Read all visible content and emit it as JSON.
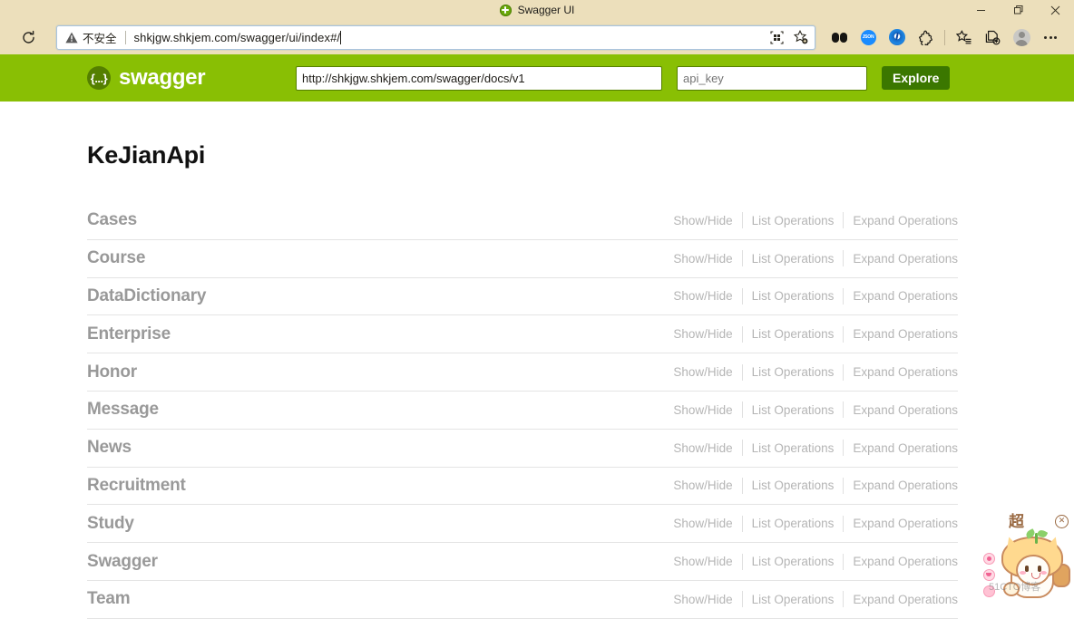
{
  "browser": {
    "tab": {
      "title": "Swagger UI",
      "favicon": "swagger-favicon"
    },
    "window_controls": {
      "minimize": "–",
      "restore": "❐",
      "close": "✕"
    },
    "toolbar": {
      "reload_label": "Reload",
      "security_label": "不安全",
      "url": "shkjgw.shkjem.com/swagger/ui/index#/",
      "qr_icon": "qr-code-icon",
      "favorite_icon": "add-favorite-star-icon",
      "extensions": [
        {
          "name": "reading-glasses-extension-icon"
        },
        {
          "name": "json-viewer-extension-icon",
          "label": "JSON"
        },
        {
          "name": "blue-disc-extension-icon"
        },
        {
          "name": "puzzle-extensions-icon"
        },
        {
          "name": "collections-star-icon"
        },
        {
          "name": "browser-essentials-icon"
        },
        {
          "name": "profile-avatar-icon"
        },
        {
          "name": "settings-more-icon"
        }
      ]
    }
  },
  "swagger_header": {
    "logo_mark": "{...}",
    "logo_text": "swagger",
    "spec_url": "http://shkjgw.shkjem.com/swagger/docs/v1",
    "api_key_placeholder": "api_key",
    "api_key_value": "",
    "explore_label": "Explore"
  },
  "page": {
    "title": "KeJianApi",
    "op_links": {
      "show_hide": "Show/Hide",
      "list_operations": "List Operations",
      "expand_operations": "Expand Operations"
    },
    "resources": [
      {
        "name": "Cases"
      },
      {
        "name": "Course"
      },
      {
        "name": "DataDictionary"
      },
      {
        "name": "Enterprise"
      },
      {
        "name": "Honor"
      },
      {
        "name": "Message"
      },
      {
        "name": "News"
      },
      {
        "name": "Recruitment"
      },
      {
        "name": "Study"
      },
      {
        "name": "Swagger"
      },
      {
        "name": "Team"
      }
    ]
  },
  "mascot_widget": {
    "super_label": "超",
    "close_label": "✕",
    "watermark": "51CTO博客",
    "side_icons": [
      {
        "name": "target-icon"
      },
      {
        "name": "message-icon"
      },
      {
        "name": "heart-icon"
      }
    ]
  },
  "colors": {
    "swagger_green": "#89bf04",
    "explore_green": "#3b7700",
    "logo_circle_green": "#547f00",
    "chrome_beige": "#ecdfbb",
    "resource_gray": "#999999",
    "link_gray": "#b5b5b5"
  }
}
